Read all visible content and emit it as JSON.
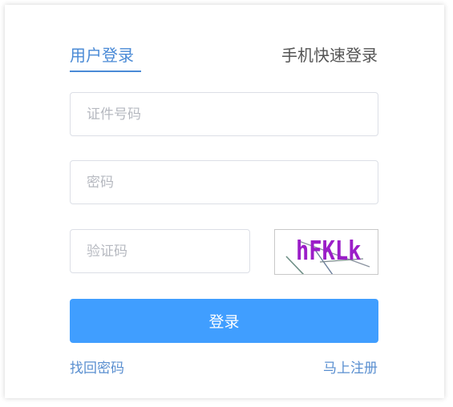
{
  "tabs": {
    "user_login": "用户登录",
    "phone_quick_login": "手机快速登录"
  },
  "form": {
    "id_number_placeholder": "证件号码",
    "password_placeholder": "密码",
    "captcha_placeholder": "验证码",
    "captcha_image_text": "hFKLk",
    "login_button": "登录"
  },
  "links": {
    "forgot_password": "找回密码",
    "register_now": "马上注册"
  },
  "colors": {
    "accent": "#409eff",
    "tab_active": "#4a8ad6",
    "link": "#5a8fd0",
    "captcha_text": "#9b1ec8"
  }
}
